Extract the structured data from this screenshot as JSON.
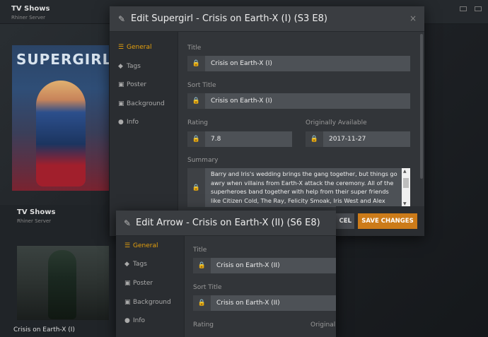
{
  "background": {
    "app_title": "TV Shows",
    "app_subtitle": "Rhiner Server",
    "poster_title": "SUPERGIRL",
    "tv2_title": "TV Shows",
    "tv2_subtitle": "Rhiner Server",
    "episode_caption": "Crisis on Earth-X (I)"
  },
  "modal1": {
    "title": "Edit Supergirl - Crisis on Earth-X (I) (S3 E8)",
    "close_icon": "×",
    "nav": [
      {
        "label": "General",
        "icon": "list-icon",
        "active": true
      },
      {
        "label": "Tags",
        "icon": "tag-icon",
        "active": false
      },
      {
        "label": "Poster",
        "icon": "image-icon",
        "active": false
      },
      {
        "label": "Background",
        "icon": "image-icon",
        "active": false
      },
      {
        "label": "Info",
        "icon": "info-icon",
        "active": false
      }
    ],
    "fields": {
      "title_label": "Title",
      "title_value": "Crisis on Earth-X (I)",
      "sort_title_label": "Sort Title",
      "sort_title_value": "Crisis on Earth-X (I)",
      "rating_label": "Rating",
      "rating_value": "7.8",
      "originally_available_label": "Originally Available",
      "originally_available_value": "2017-11-27",
      "summary_label": "Summary",
      "summary_value": "Barry and Iris's wedding brings the gang together, but things go awry when villains from Earth-X attack the ceremony. All of the superheroes band together with help from their super friends like Citizen Cold, The Ray, Felicity Smoak, Iris West and Alex"
    },
    "cancel_label": "CEL",
    "save_label": "SAVE CHANGES"
  },
  "modal2": {
    "title": "Edit Arrow - Crisis on Earth-X (II) (S6 E8)",
    "nav": [
      {
        "label": "General",
        "icon": "list-icon",
        "active": true
      },
      {
        "label": "Tags",
        "icon": "tag-icon",
        "active": false
      },
      {
        "label": "Poster",
        "icon": "image-icon",
        "active": false
      },
      {
        "label": "Background",
        "icon": "image-icon",
        "active": false
      },
      {
        "label": "Info",
        "icon": "info-icon",
        "active": false
      }
    ],
    "fields": {
      "title_label": "Title",
      "title_value": "Crisis on Earth-X (II)",
      "sort_title_label": "Sort Title",
      "sort_title_value": "Crisis on Earth-X (II)",
      "rating_label": "Rating",
      "originally_label": "Originally"
    }
  },
  "colors": {
    "accent": "#e5a00d",
    "save_button": "#cc7b19"
  }
}
